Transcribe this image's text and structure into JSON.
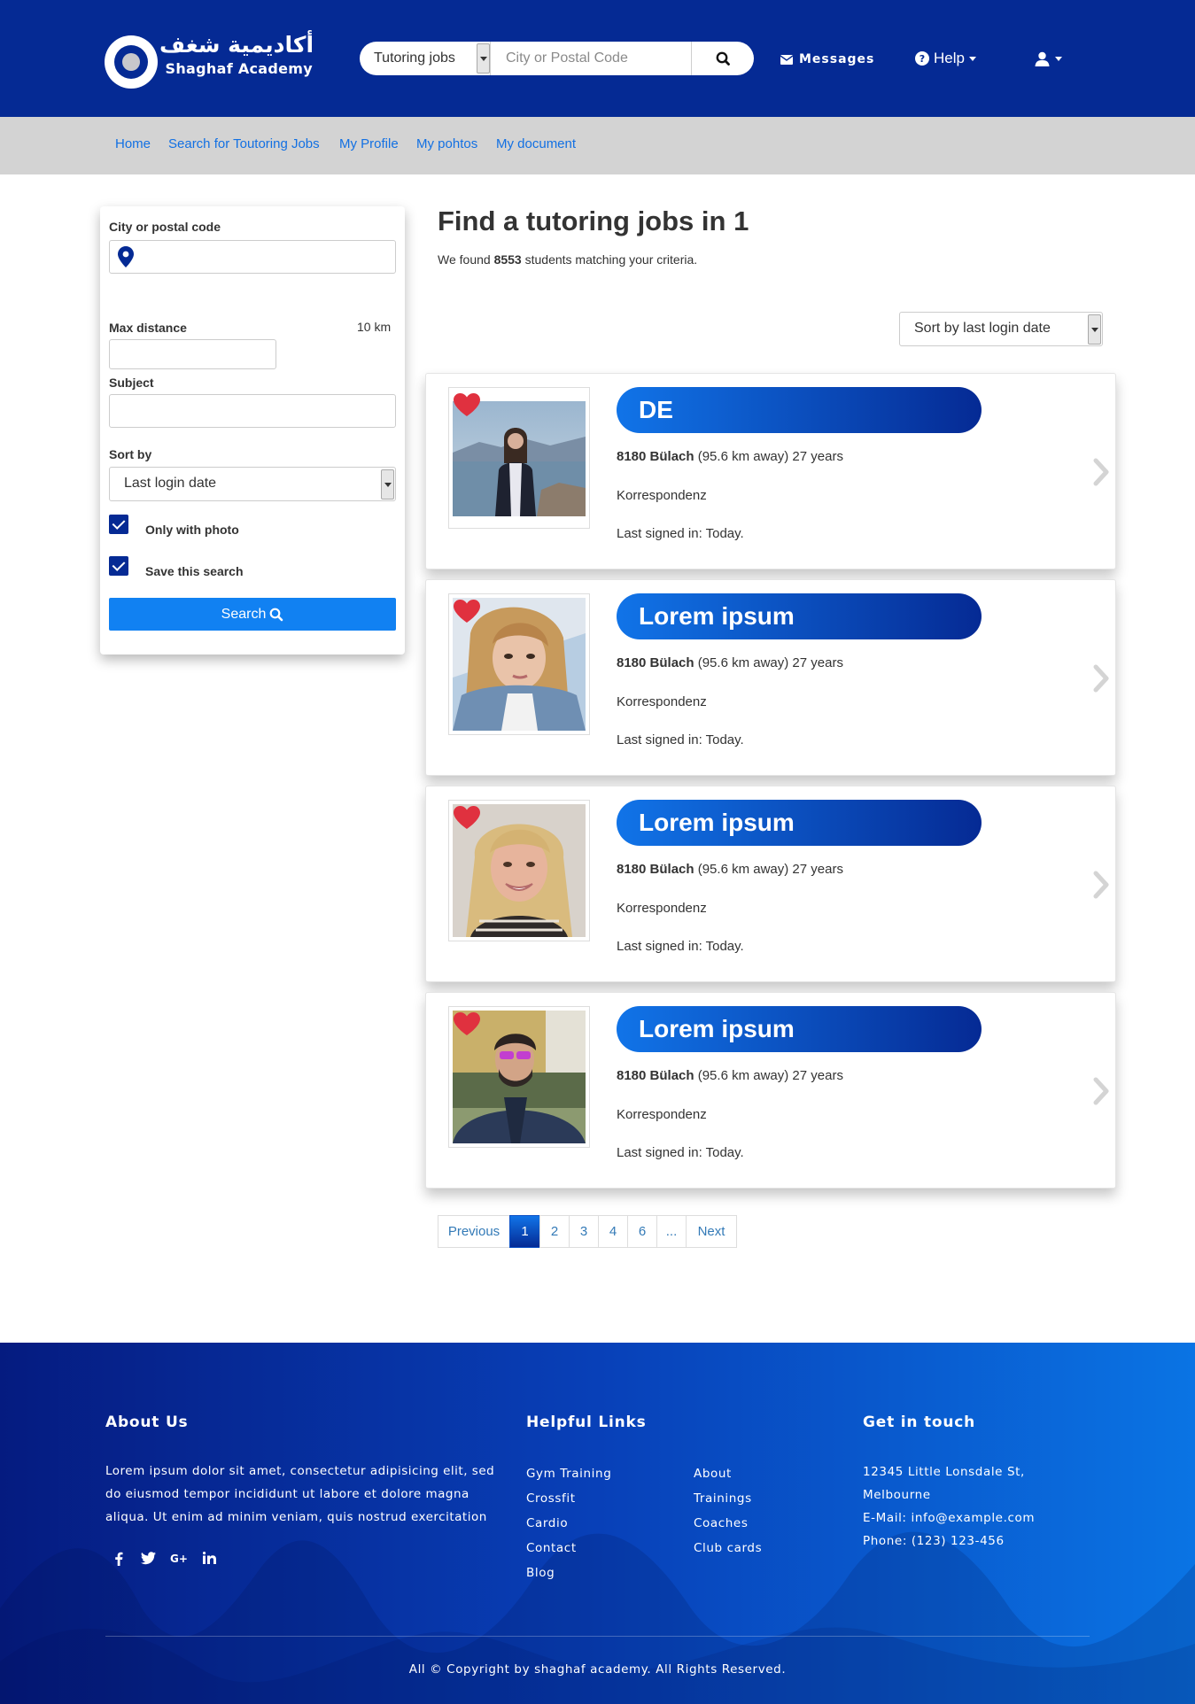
{
  "header": {
    "logo_arabic": "أكاديمية شغف",
    "logo_english": "Shaghaf Academy",
    "search": {
      "category_selected": "Tutoring jobs",
      "location_placeholder": "City or Postal Code"
    },
    "messages_label": "Messages",
    "help_label": "Help"
  },
  "subnav": {
    "items": [
      {
        "label": "Home"
      },
      {
        "label": "Search for Toutoring Jobs"
      },
      {
        "label": "My Profile"
      },
      {
        "label": "My pohtos"
      },
      {
        "label": "My document"
      }
    ]
  },
  "filter": {
    "city_label": "City or postal code",
    "max_distance_label": "Max distance",
    "max_distance_value": "10 km",
    "subject_label": "Subject",
    "sort_by_label": "Sort by",
    "sort_by_selected": "Last login date",
    "only_with_photo_label": "Only with photo",
    "only_with_photo_checked": true,
    "save_search_label": "Save this search",
    "save_search_checked": true,
    "search_button_label": "Search"
  },
  "results": {
    "title": "Find a tutoring jobs in 1",
    "count_prefix": "We found",
    "count": "8553",
    "count_suffix": "students matching your criteria.",
    "sort_selected": "Sort by last login date",
    "cards": [
      {
        "name": "DE",
        "location": "8180 Bülach",
        "distance": "(95.6 km away) 27 years",
        "subject": "Korrespondenz",
        "last_login": "Last signed in: Today."
      },
      {
        "name": "Lorem ipsum",
        "location": "8180 Bülach",
        "distance": "(95.6 km away) 27 years",
        "subject": "Korrespondenz",
        "last_login": "Last signed in: Today."
      },
      {
        "name": "Lorem ipsum",
        "location": "8180 Bülach",
        "distance": "(95.6 km away) 27 years",
        "subject": "Korrespondenz",
        "last_login": "Last signed in: Today."
      },
      {
        "name": "Lorem ipsum",
        "location": "8180 Bülach",
        "distance": "(95.6 km away) 27 years",
        "subject": "Korrespondenz",
        "last_login": "Last signed in: Today."
      }
    ]
  },
  "pagination": {
    "previous_label": "Previous",
    "pages": [
      "1",
      "2",
      "3",
      "4",
      "6",
      "..."
    ],
    "active_page": "1",
    "next_label": "Next"
  },
  "footer": {
    "about_title": "About Us",
    "about_text": "Lorem ipsum dolor sit amet, consectetur adipisicing elit, sed do eiusmod tempor incididunt ut labore et dolore magna aliqua. Ut enim ad minim veniam, quis nostrud exercitation",
    "links_title": "Helpful Links",
    "links_col1": [
      "Gym Training",
      "Crossfit",
      "Cardio",
      "Contact",
      "Blog"
    ],
    "links_col2": [
      "About",
      "Trainings",
      "Coaches",
      "Club cards"
    ],
    "contact_title": "Get in touch",
    "address_line1": "12345 Little Lonsdale St,",
    "address_line2": "Melbourne",
    "email": "E-Mail: info@example.com",
    "phone": "Phone: (123) 123-456",
    "copyright": "All © Copyright by shaghaf academy. All Rights Reserved."
  },
  "colors": {
    "brand_navy": "#052a94",
    "accent_blue": "#1181f2",
    "link_blue": "#1270e3",
    "heart_red": "#e0313f"
  }
}
